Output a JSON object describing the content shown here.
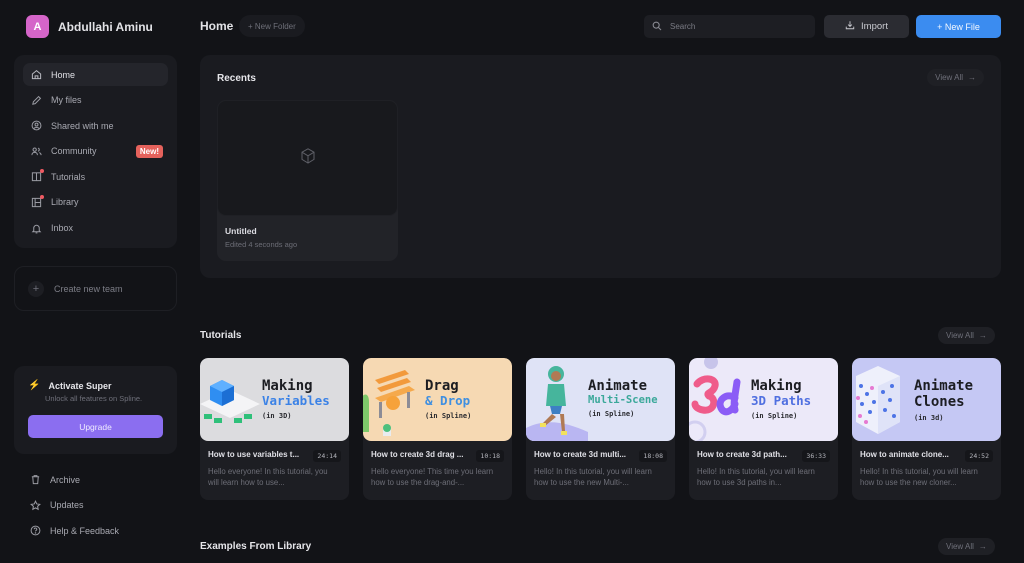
{
  "user": {
    "initial": "A",
    "name": "Abdullahi Aminu",
    "avatar_color": "#d565c9"
  },
  "header": {
    "title": "Home",
    "new_folder_label": "+ New Folder",
    "search_placeholder": "Search",
    "import_label": "Import",
    "new_file_label": "+ New File",
    "accent_color": "#3b8cf0"
  },
  "sidebar": {
    "items": [
      {
        "label": "Home",
        "icon": "home-icon",
        "active": true
      },
      {
        "label": "My files",
        "icon": "pencil-icon"
      },
      {
        "label": "Shared with me",
        "icon": "user-circle-icon"
      },
      {
        "label": "Community",
        "icon": "users-icon",
        "badge": "New!"
      },
      {
        "label": "Tutorials",
        "icon": "book-icon",
        "dot": true
      },
      {
        "label": "Library",
        "icon": "library-icon",
        "dot": true
      },
      {
        "label": "Inbox",
        "icon": "bell-icon"
      }
    ],
    "create_team_label": "Create new team",
    "super": {
      "title": "Activate Super",
      "subtitle": "Unlock all features on Spline.",
      "button_label": "Upgrade",
      "accent_color": "#8b6ef0"
    },
    "bottom_items": [
      {
        "label": "Archive",
        "icon": "trash-icon"
      },
      {
        "label": "Updates",
        "icon": "star-icon"
      },
      {
        "label": "Help & Feedback",
        "icon": "help-icon"
      }
    ]
  },
  "recents": {
    "title": "Recents",
    "view_all_label": "View All",
    "files": [
      {
        "name": "Untitled",
        "edited": "Edited 4 seconds ago"
      }
    ]
  },
  "tutorials": {
    "title": "Tutorials",
    "view_all_label": "View All",
    "items": [
      {
        "thumb_line1": "Making",
        "thumb_line2": "Variables",
        "thumb_line3": "(in 3D)",
        "thumb_bg": "#dcdcdf",
        "thumb_accent": "#3b82e6",
        "title": "How to use variables t...",
        "duration": "24:14",
        "description": "Hello everyone! In this tutorial, you will learn how to use..."
      },
      {
        "thumb_line1": "Drag",
        "thumb_line2": "& Drop",
        "thumb_line3": "(in Spline)",
        "thumb_bg": "#f6d9b3",
        "thumb_accent": "#3f8fe0",
        "title": "How to create 3d drag ...",
        "duration": "10:18",
        "description": "Hello everyone! This time you learn how to use the drag-and-..."
      },
      {
        "thumb_line1": "Animate",
        "thumb_line2": "Multi-Scene",
        "thumb_line3": "(in Spline)",
        "thumb_bg": "#dfe3f6",
        "thumb_accent": "#3ba89a",
        "title": "How to create 3d multi...",
        "duration": "18:08",
        "description": "Hello! In this tutorial, you will learn how to use the new Multi-..."
      },
      {
        "thumb_line1": "Making",
        "thumb_line2": "3D Paths",
        "thumb_line3": "(in Spline)",
        "thumb_bg": "#ece9f9",
        "thumb_accent": "#4f6fe0",
        "title": "How to create 3d path...",
        "duration": "36:33",
        "description": "Hello! In this tutorial, you will learn how to use 3d paths in..."
      },
      {
        "thumb_line1": "Animate",
        "thumb_line2": "Clones",
        "thumb_line3": "(in 3d)",
        "thumb_bg": "#c5c8f4",
        "thumb_accent": "#1c1d22",
        "title": "How to animate clone...",
        "duration": "24:52",
        "description": "Hello! In this tutorial, you will learn how to use the new cloner..."
      }
    ]
  },
  "examples": {
    "title": "Examples From Library",
    "view_all_label": "View All"
  }
}
